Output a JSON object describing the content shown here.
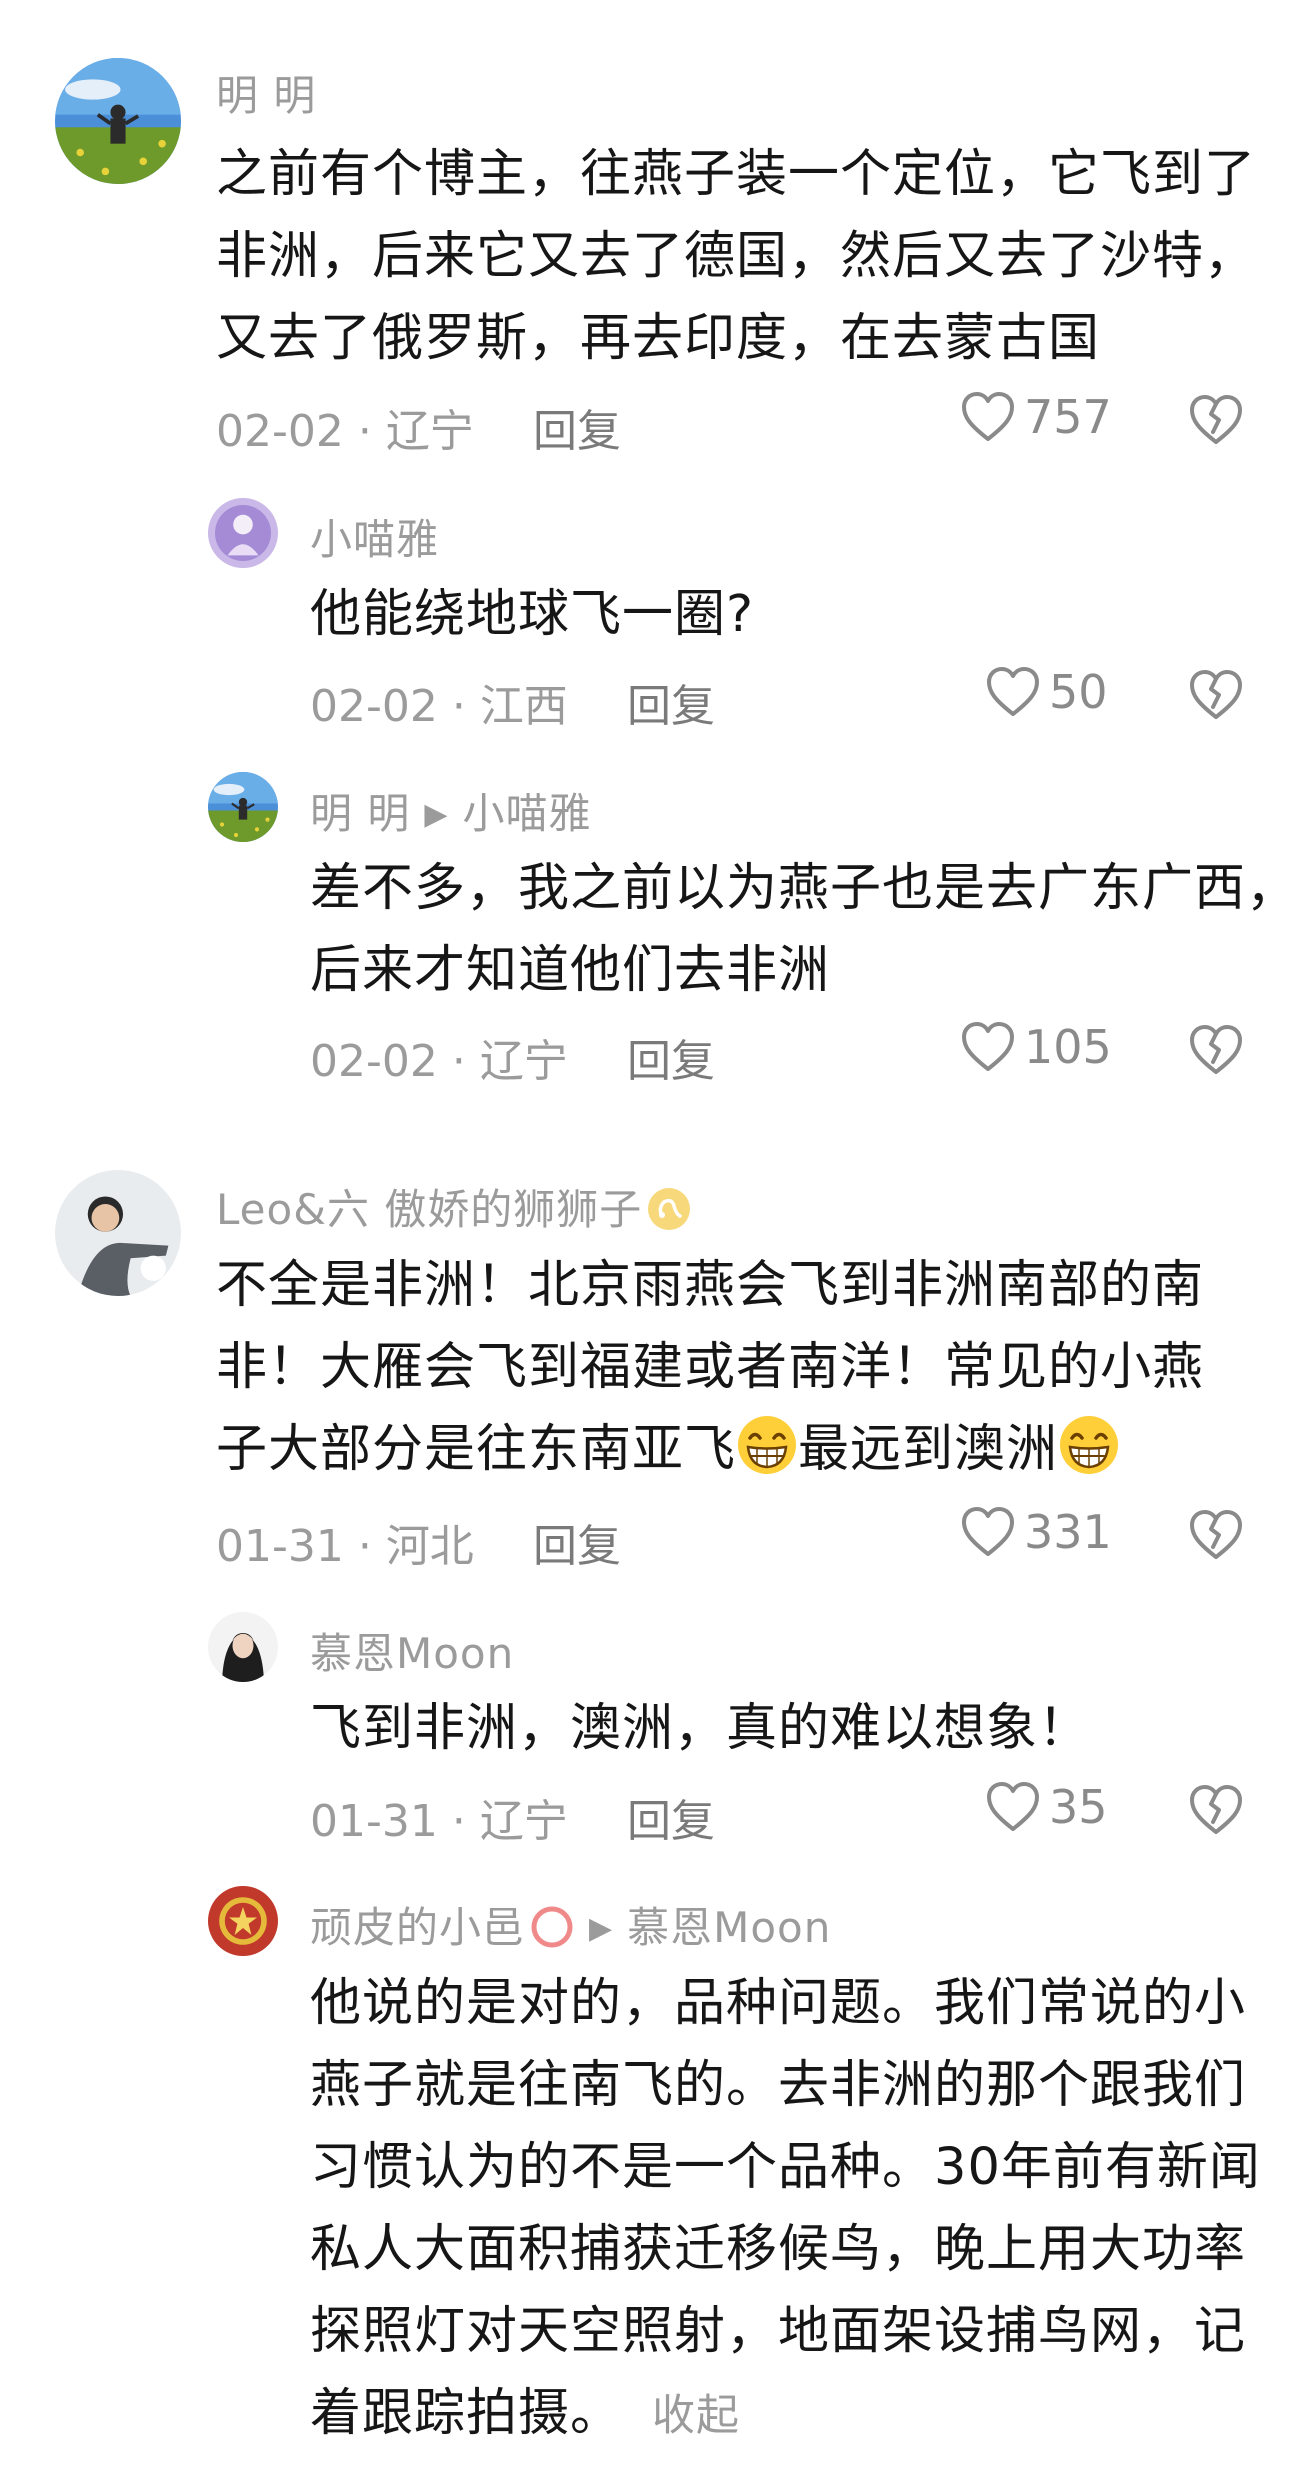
{
  "comments": [
    {
      "user": "明 明",
      "text_lines": [
        "之前有个博主，往燕子装一个定位，它飞到了",
        "非洲，后来它又去了德国，然后又去了沙特，",
        "又去了俄罗斯，再去印度，在去蒙古国"
      ],
      "meta": "02-02 · 辽宁",
      "reply_label": "回复",
      "likes": "757"
    },
    {
      "user": "小喵雅",
      "text_lines": [
        "他能绕地球飞一圈?"
      ],
      "meta": "02-02 · 江西",
      "reply_label": "回复",
      "likes": "50"
    },
    {
      "user": "明 明",
      "reply_to": "小喵雅",
      "text_lines": [
        "差不多，我之前以为燕子也是去广东广西，",
        "后来才知道他们去非洲"
      ],
      "meta": "02-02 · 辽宁",
      "reply_label": "回复",
      "likes": "105"
    },
    {
      "user": "Leo&六 傲娇的狮狮子",
      "text_lines": [
        "不全是非洲！北京雨燕会飞到非洲南部的南",
        "非！大雁会飞到福建或者南洋！常见的小燕",
        "子大部分是往东南亚飞",
        "最远到澳洲"
      ],
      "meta": "01-31 · 河北",
      "reply_label": "回复",
      "likes": "331"
    },
    {
      "user": "慕恩Moon",
      "text_lines": [
        "飞到非洲，澳洲，真的难以想象！"
      ],
      "meta": "01-31 · 辽宁",
      "reply_label": "回复",
      "likes": "35"
    },
    {
      "user": "顽皮的小邑",
      "reply_to": "慕恩Moon",
      "text_lines": [
        "他说的是对的，品种问题。我们常说的小",
        "燕子就是往南飞的。去非洲的那个跟我们",
        "习惯认为的不是一个品种。30年前有新闻",
        "私人大面积捕获迁移候鸟，晚上用大功率",
        "探照灯对天空照射，地面架设捕鸟网，记",
        "着跟踪拍摄。"
      ],
      "collapse_label": "收起"
    }
  ]
}
